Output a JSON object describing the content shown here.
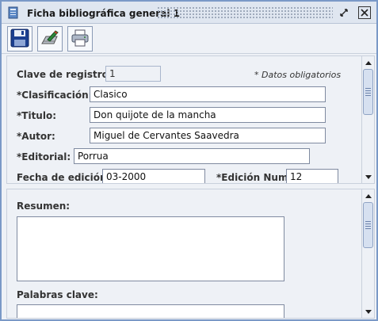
{
  "window": {
    "title": "Ficha bibliográfica general 1"
  },
  "form": {
    "note": "* Datos obligatorios",
    "clave": {
      "label": "Clave de registro:",
      "value": "1"
    },
    "clasificacion": {
      "label": "*Clasificación:",
      "value": "Clasico"
    },
    "titulo": {
      "label": "*Titulo:",
      "value": "Don quijote de la mancha"
    },
    "autor": {
      "label": "*Autor:",
      "value": "Miguel de Cervantes Saavedra"
    },
    "editorial": {
      "label": "*Editorial:",
      "value": "Porrua"
    },
    "fecha": {
      "label": "Fecha de edición:",
      "value": "03-2000"
    },
    "edicion": {
      "label": "*Edición Num:",
      "value": "12"
    }
  },
  "details": {
    "resumen": {
      "label": "Resumen:",
      "value": ""
    },
    "palabras": {
      "label": "Palabras clave:",
      "value": ""
    }
  },
  "icons": [
    "document-icon",
    "restore-icon",
    "close-icon",
    "save-icon",
    "edit-icon",
    "print-icon"
  ]
}
